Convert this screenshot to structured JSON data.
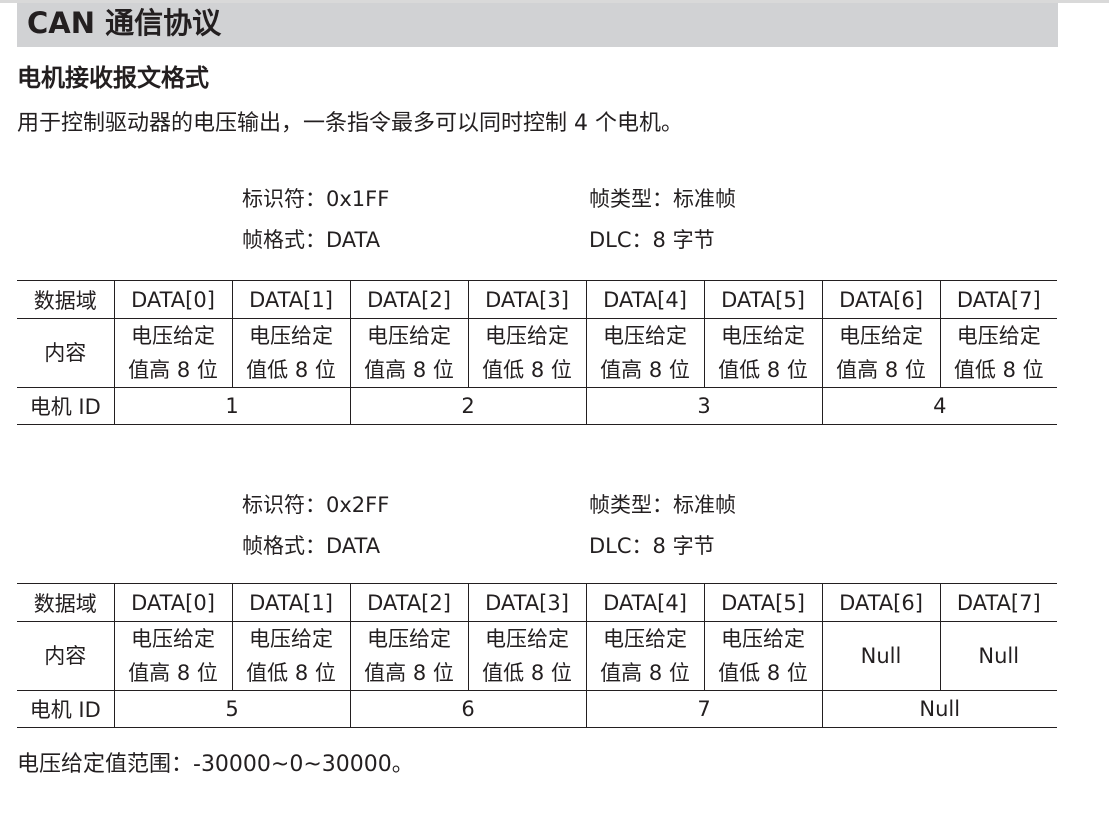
{
  "section_title": "CAN 通信协议",
  "sub_title": "电机接收报文格式",
  "intro": "用于控制驱动器的电压输出，一条指令最多可以同时控制 4 个电机。",
  "frames": [
    {
      "identifier": "标识符：0x1FF",
      "frame_type": "帧类型：标准帧",
      "frame_format": "帧格式：DATA",
      "dlc": "DLC：8 字节",
      "table": {
        "field_label": "数据域",
        "fields": [
          "DATA[0]",
          "DATA[1]",
          "DATA[2]",
          "DATA[3]",
          "DATA[4]",
          "DATA[5]",
          "DATA[6]",
          "DATA[7]"
        ],
        "content_label": "内容",
        "contents": [
          [
            "电压给定",
            "值高 8 位"
          ],
          [
            "电压给定",
            "值低 8 位"
          ],
          [
            "电压给定",
            "值高 8 位"
          ],
          [
            "电压给定",
            "值低 8 位"
          ],
          [
            "电压给定",
            "值高 8 位"
          ],
          [
            "电压给定",
            "值低 8 位"
          ],
          [
            "电压给定",
            "值高 8 位"
          ],
          [
            "电压给定",
            "值低 8 位"
          ]
        ],
        "motor_label": "电机 ID",
        "motor_ids": [
          "1",
          "2",
          "3",
          "4"
        ]
      }
    },
    {
      "identifier": "标识符：0x2FF",
      "frame_type": "帧类型：标准帧",
      "frame_format": "帧格式：DATA",
      "dlc": "DLC：8 字节",
      "table": {
        "field_label": "数据域",
        "fields": [
          "DATA[0]",
          "DATA[1]",
          "DATA[2]",
          "DATA[3]",
          "DATA[4]",
          "DATA[5]",
          "DATA[6]",
          "DATA[7]"
        ],
        "content_label": "内容",
        "contents": [
          [
            "电压给定",
            "值高 8 位"
          ],
          [
            "电压给定",
            "值低 8 位"
          ],
          [
            "电压给定",
            "值高 8 位"
          ],
          [
            "电压给定",
            "值低 8 位"
          ],
          [
            "电压给定",
            "值高 8 位"
          ],
          [
            "电压给定",
            "值低 8 位"
          ],
          [
            "Null"
          ],
          [
            "Null"
          ]
        ],
        "motor_label": "电机 ID",
        "motor_ids": [
          "5",
          "6",
          "7",
          "Null"
        ]
      }
    }
  ],
  "footer_note": "电压给定值范围：-30000~0~30000。"
}
